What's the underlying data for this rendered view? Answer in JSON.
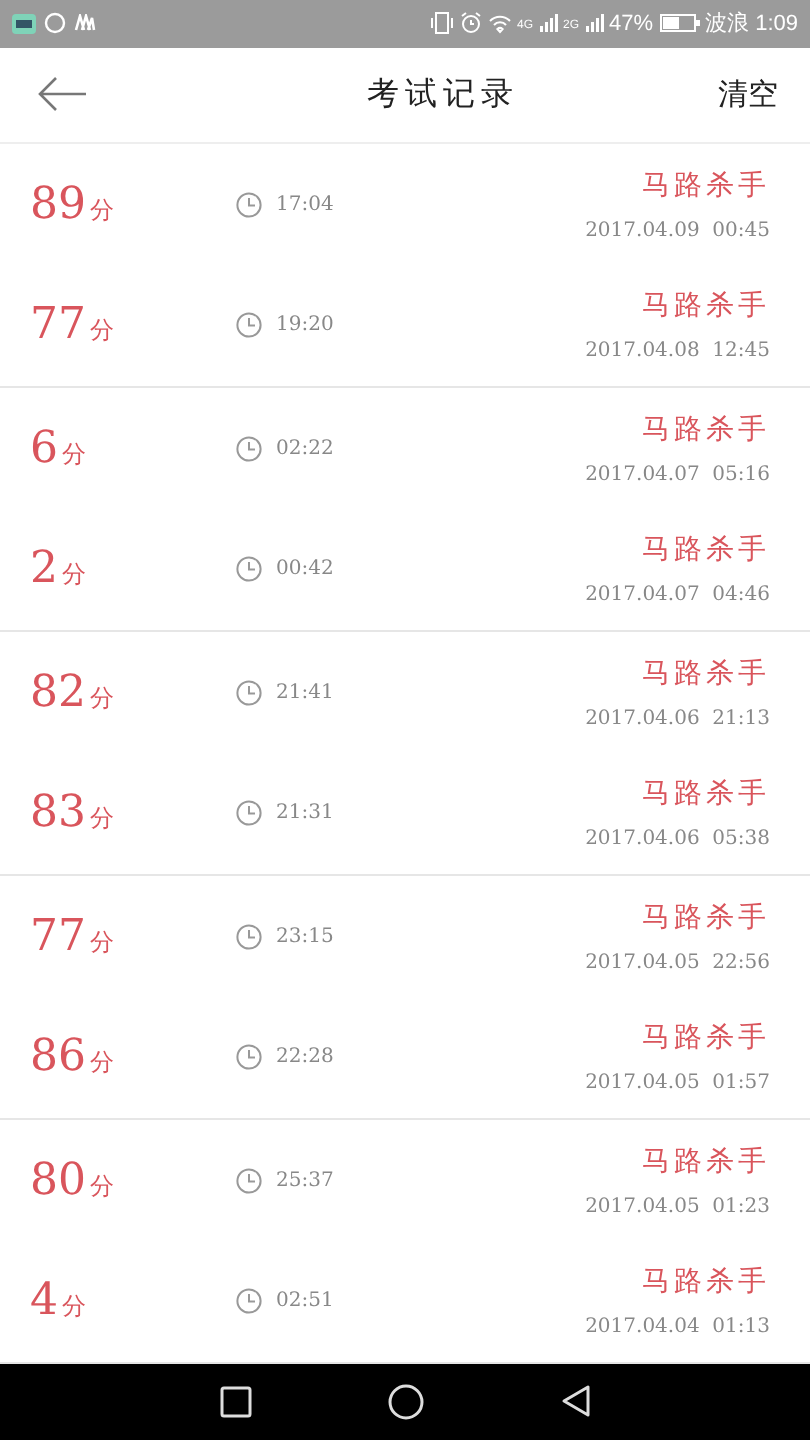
{
  "status_bar": {
    "signal_1": "4G",
    "signal_2": "2G",
    "battery": "47%",
    "carrier": "波浪",
    "time": "1:09"
  },
  "header": {
    "title": "考试记录",
    "action": "清空"
  },
  "records": [
    {
      "score": "89",
      "unit": "分",
      "duration": "17:04",
      "name": "马路杀手",
      "date": "2017.04.09  00:45"
    },
    {
      "score": "77",
      "unit": "分",
      "duration": "19:20",
      "name": "马路杀手",
      "date": "2017.04.08  12:45"
    },
    {
      "score": "6",
      "unit": "分",
      "duration": "02:22",
      "name": "马路杀手",
      "date": "2017.04.07  05:16"
    },
    {
      "score": "2",
      "unit": "分",
      "duration": "00:42",
      "name": "马路杀手",
      "date": "2017.04.07  04:46"
    },
    {
      "score": "82",
      "unit": "分",
      "duration": "21:41",
      "name": "马路杀手",
      "date": "2017.04.06  21:13"
    },
    {
      "score": "83",
      "unit": "分",
      "duration": "21:31",
      "name": "马路杀手",
      "date": "2017.04.06  05:38"
    },
    {
      "score": "77",
      "unit": "分",
      "duration": "23:15",
      "name": "马路杀手",
      "date": "2017.04.05  22:56"
    },
    {
      "score": "86",
      "unit": "分",
      "duration": "22:28",
      "name": "马路杀手",
      "date": "2017.04.05  01:57"
    },
    {
      "score": "80",
      "unit": "分",
      "duration": "25:37",
      "name": "马路杀手",
      "date": "2017.04.05  01:23"
    },
    {
      "score": "4",
      "unit": "分",
      "duration": "02:51",
      "name": "马路杀手",
      "date": "2017.04.04  01:13"
    }
  ]
}
